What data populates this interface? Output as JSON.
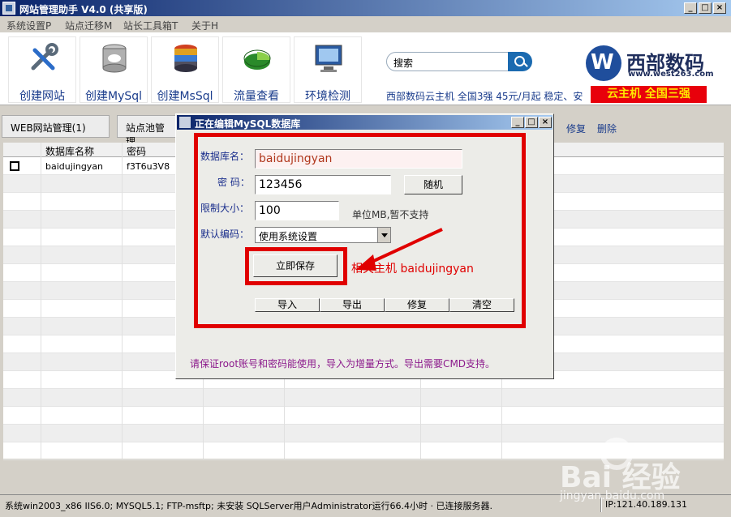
{
  "window": {
    "title": "网站管理助手 V4.0 (共享版)",
    "btn_min": "_",
    "btn_max": "□",
    "btn_close": "×"
  },
  "menu": [
    "系统设置P",
    "站点迁移M",
    "站长工具箱T",
    "关于H"
  ],
  "toolbar": [
    {
      "label": "创建网站",
      "icon": "tools-icon"
    },
    {
      "label": "创建MySql",
      "icon": "mysql-database-icon"
    },
    {
      "label": "创建MsSql",
      "icon": "mssql-database-icon"
    },
    {
      "label": "流量查看",
      "icon": "traffic-chart-icon"
    },
    {
      "label": "环境检测",
      "icon": "monitor-icon"
    }
  ],
  "search": {
    "value": "搜索"
  },
  "brand": {
    "name": "西部数码",
    "url": "www.west263.com"
  },
  "promo": {
    "text": "西部数码云主机  全国3强  45元/月起  稳定、安",
    "red": "云主机  全国三强"
  },
  "tabs": [
    "WEB网站管理(1)",
    "站点池管理"
  ],
  "actions": [
    "修复",
    "删除"
  ],
  "grid": {
    "headers": [
      "数据库名称",
      "密码"
    ],
    "rows": [
      {
        "name": "baidujingyan",
        "password": "f3T6u3V8"
      }
    ]
  },
  "dialog": {
    "title": "正在编辑MySQL数据库",
    "btn_min": "_",
    "btn_max": "□",
    "btn_close": "×",
    "db_label": "数据库名：",
    "db_value": "baidujingyan",
    "pwd_label": "密  码：",
    "pwd_value": "123456",
    "random_btn": "随机",
    "size_label": "限制大小：",
    "size_value": "100",
    "size_note": "单位MB,暂不支持",
    "encoding_label": "默认编码：",
    "encoding_value": "使用系统设置",
    "save_btn": "立即保存",
    "annotation": "相关主机 baidujingyan",
    "bottom_btns": [
      "导入",
      "导出",
      "修复",
      "清空"
    ],
    "hint": "请保证root账号和密码能使用，导入为增量方式。导出需要CMD支持。"
  },
  "status": {
    "left": "系统win2003_x86 IIS6.0; MYSQL5.1; FTP-msftp; 未安装 SQLServer用户Administrator运行66.4小时 · 已连接服务器.",
    "right": "IP:121.40.189.131"
  },
  "watermark": {
    "text": "Bai 经验",
    "url": "jingyan.baidu.com"
  },
  "colors": {
    "annotation_red": "#e00000",
    "link_blue": "#1a3c8c",
    "title_blue": "#0a246a"
  }
}
